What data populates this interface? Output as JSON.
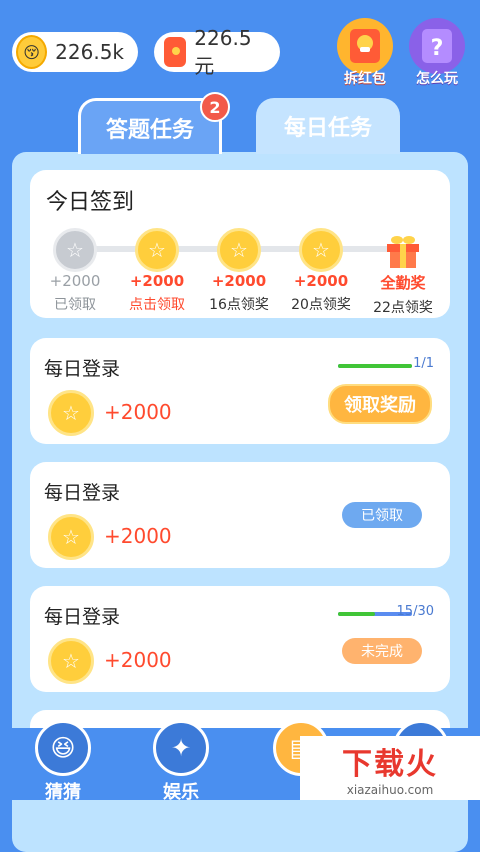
{
  "topbar": {
    "coins": "226.5k",
    "cash": "226.5元",
    "red_packet_label": "拆红包",
    "how_to_play_label": "怎么玩"
  },
  "tabs": [
    {
      "label": "答题任务",
      "badge": "2"
    },
    {
      "label": "每日任务"
    }
  ],
  "checkin": {
    "title": "今日签到",
    "days": [
      {
        "amount": "+2000",
        "status": "已领取"
      },
      {
        "amount": "+2000",
        "status": "点击领取"
      },
      {
        "amount": "+2000",
        "status": "16点领奖"
      },
      {
        "amount": "+2000",
        "status": "20点领奖"
      },
      {
        "amount": "全勤奖",
        "status": "22点领奖"
      }
    ]
  },
  "tasks": [
    {
      "name": "每日登录",
      "reward": "+2000",
      "progress": "1/1",
      "progress_fraction": 1.0,
      "action": "领取奖励"
    },
    {
      "name": "每日登录",
      "reward": "+2000",
      "action": "已领取"
    },
    {
      "name": "每日登录",
      "reward": "+2000",
      "progress": "15/30",
      "progress_fraction": 0.5,
      "action": "未完成"
    }
  ],
  "bottom_nav": [
    {
      "label": "猜猜"
    },
    {
      "label": "娱乐"
    }
  ],
  "watermark": {
    "brand": "下载火",
    "domain": "xiazaihuo.com"
  },
  "colors": {
    "background": "#4a8ff0",
    "panel": "#bde3ff",
    "accent_red": "#ff4a2e",
    "claim_button": "#ffb640"
  }
}
